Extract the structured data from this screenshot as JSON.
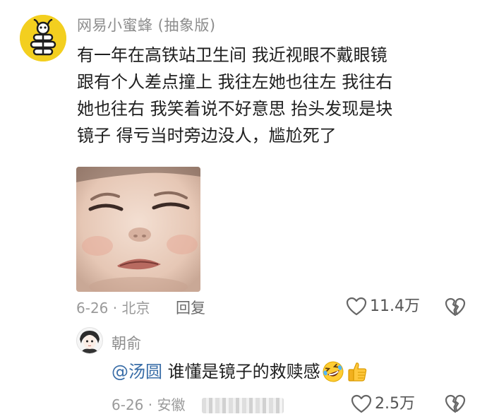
{
  "comment": {
    "avatar_icon": "bee-icon",
    "username": "网易小蜜蜂 (抽象版)",
    "text_lines": [
      "有一年在高铁站卫生间 我近视眼不戴眼镜",
      "跟有个人差点撞上 我往左她也往左 我往右",
      "她也往右 我笑着说不好意思 抬头发现是块",
      "镜子 得亏当时旁边没人，尴尬死了"
    ],
    "image": "crying-child-meme",
    "date_location": "6-26 · 北京",
    "reply_label": "回复",
    "likes": "11.4万",
    "like_icon": "heart-icon",
    "dislike_icon": "broken-heart-icon"
  },
  "reply": {
    "avatar_icon": "anime-avatar-icon",
    "username": "朝俞",
    "mention": "@汤圆",
    "text": " 谁懂是镜子的救赎感",
    "emojis": [
      "rolling-laughing-emoji",
      "thumbs-up-emoji"
    ],
    "date_location": "6-26 · 安徽",
    "likes": "2.5万",
    "like_icon": "heart-icon",
    "dislike_icon": "broken-heart-icon"
  },
  "colors": {
    "avatar_bg": "#f3cf1f",
    "mention": "#3a6ea8",
    "meta_text": "#9a9a9a"
  }
}
